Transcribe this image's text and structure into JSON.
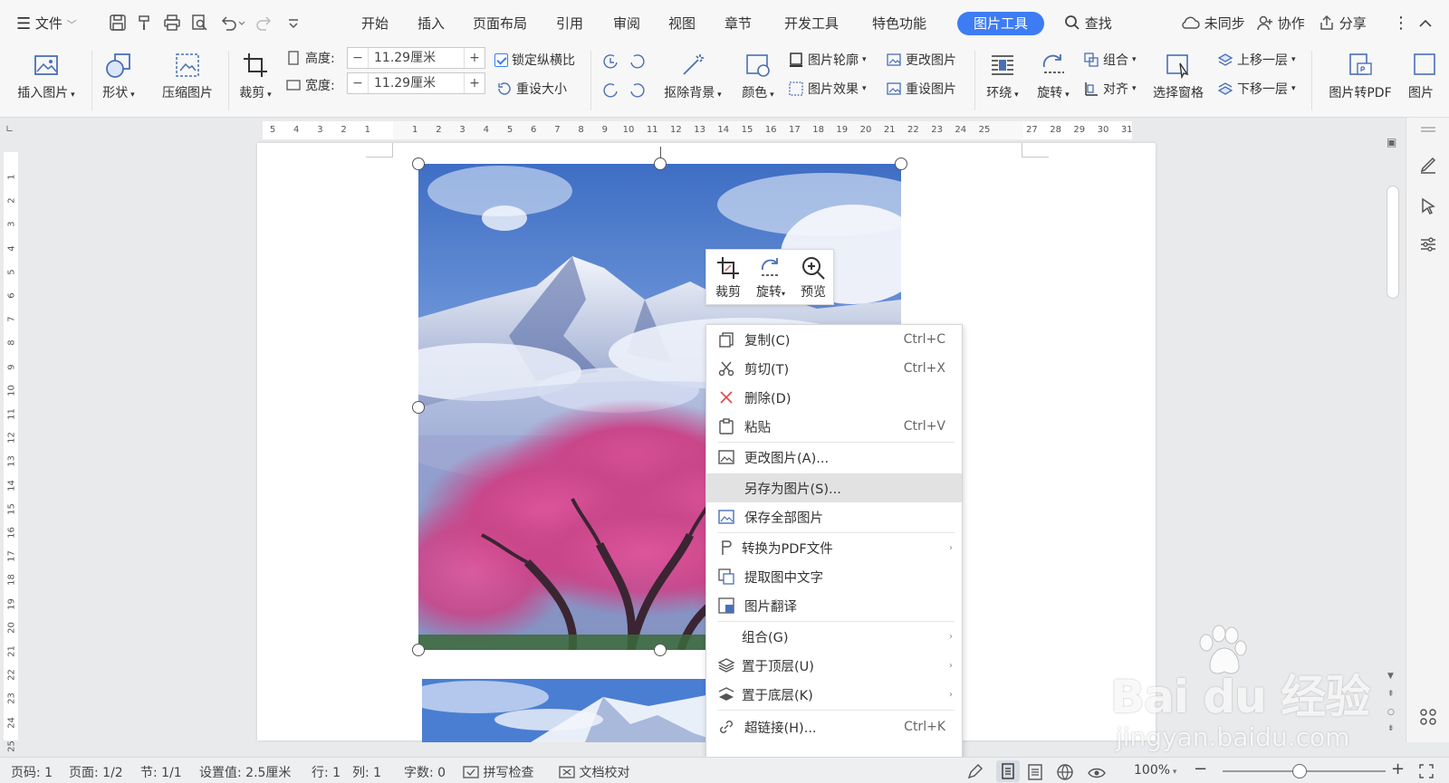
{
  "menubar": {
    "file_label": "文件",
    "tabs": [
      "开始",
      "插入",
      "页面布局",
      "引用",
      "审阅",
      "视图",
      "章节",
      "开发工具",
      "特色功能"
    ],
    "active_tab": "图片工具",
    "search_label": "查找",
    "sync_label": "未同步",
    "collab_label": "协作",
    "share_label": "分享"
  },
  "ribbon": {
    "insert_picture": "插入图片",
    "shape": "形状",
    "compress": "压缩图片",
    "crop": "裁剪",
    "height_label": "高度:",
    "height_value": "11.29厘米",
    "width_label": "宽度:",
    "width_value": "11.29厘米",
    "lock_ratio": "锁定纵横比",
    "reset_size": "重设大小",
    "remove_bg": "抠除背景",
    "color": "颜色",
    "outline": "图片轮廓",
    "change_picture": "更改图片",
    "effects": "图片效果",
    "reset_picture": "重设图片",
    "wrap": "环绕",
    "rotate": "旋转",
    "group": "组合",
    "align": "对齐",
    "selection_pane": "选择窗格",
    "bring_forward": "上移一层",
    "send_backward": "下移一层",
    "to_pdf": "图片转PDF",
    "more": "图片"
  },
  "ruler": {
    "h_left": [
      "5",
      "4",
      "3",
      "2",
      "1"
    ],
    "h_right": [
      "1",
      "2",
      "3",
      "4",
      "5",
      "6",
      "7",
      "8",
      "9",
      "10",
      "11",
      "12",
      "13",
      "14",
      "15",
      "16",
      "17",
      "18",
      "19",
      "20",
      "21",
      "22",
      "23",
      "24",
      "25"
    ],
    "h_far": [
      "27",
      "28",
      "29",
      "30",
      "31"
    ],
    "v": [
      "1",
      "2",
      "3",
      "4",
      "5",
      "6",
      "7",
      "8",
      "9",
      "10",
      "11",
      "12",
      "13",
      "14",
      "15",
      "16",
      "17",
      "18",
      "19",
      "20",
      "21",
      "22",
      "23",
      "24",
      "25"
    ]
  },
  "minibar": {
    "crop": "裁剪",
    "rotate": "旋转",
    "preview": "预览"
  },
  "context_menu": {
    "items": [
      {
        "label": "复制(C)",
        "shortcut": "Ctrl+C"
      },
      {
        "label": "剪切(T)",
        "shortcut": "Ctrl+X"
      },
      {
        "label": "删除(D)",
        "shortcut": ""
      },
      {
        "label": "粘贴",
        "shortcut": "Ctrl+V"
      },
      {
        "label": "更改图片(A)...",
        "shortcut": ""
      },
      {
        "label": "另存为图片(S)...",
        "shortcut": ""
      },
      {
        "label": "保存全部图片",
        "shortcut": ""
      },
      {
        "label": "转换为PDF文件",
        "shortcut": ""
      },
      {
        "label": "提取图中文字",
        "shortcut": ""
      },
      {
        "label": "图片翻译",
        "shortcut": ""
      },
      {
        "label": "组合(G)",
        "shortcut": ""
      },
      {
        "label": "置于顶层(U)",
        "shortcut": ""
      },
      {
        "label": "置于底层(K)",
        "shortcut": ""
      },
      {
        "label": "超链接(H)...",
        "shortcut": "Ctrl+K"
      }
    ]
  },
  "status": {
    "page_num": "页码: 1",
    "pages": "页面: 1/2",
    "section": "节: 1/1",
    "setting": "设置值: 2.5厘米",
    "row": "行: 1",
    "col": "列: 1",
    "words": "字数: 0",
    "spell": "拼写检查",
    "proof": "文档校对",
    "zoom": "100%"
  },
  "watermark": {
    "brand": "Bai  du 经验",
    "url": "jingyan.baidu.com"
  },
  "colors": {
    "accent": "#3d7cf2",
    "highlight": "#e2e2e2",
    "delete_icon": "#e04848"
  }
}
